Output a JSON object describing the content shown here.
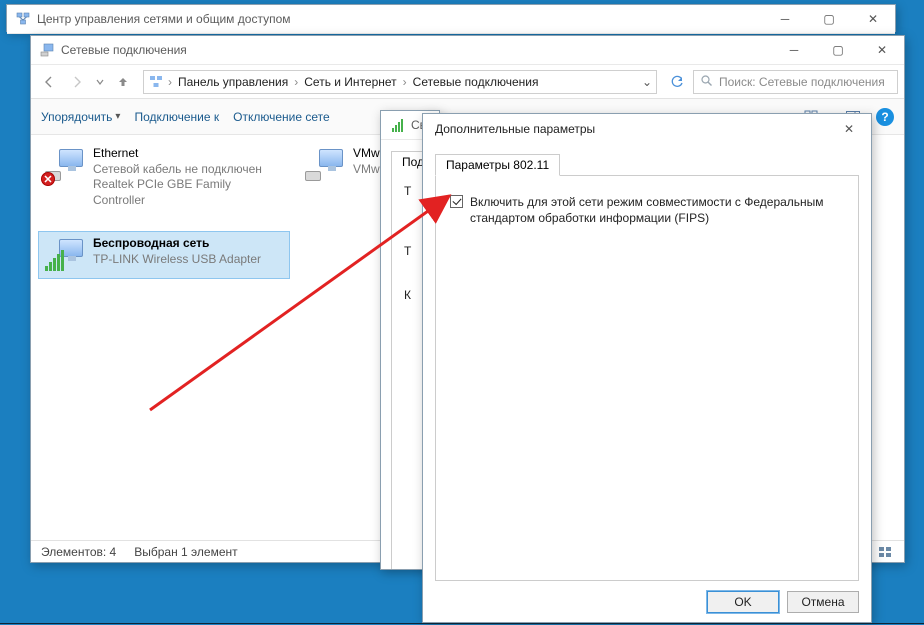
{
  "bg_window": {
    "title": "Центр управления сетями и общим доступом"
  },
  "window": {
    "title": "Сетевые подключения",
    "breadcrumbs": {
      "b1": "Панель управления",
      "b2": "Сеть и Интернет",
      "b3": "Сетевые подключения"
    },
    "search_placeholder": "Поиск: Сетевые подключения",
    "toolbar": {
      "organize": "Упорядочить",
      "connect_to": "Подключение к",
      "disable": "Отключение сете"
    },
    "conn1": {
      "name": "Ethernet",
      "status": "Сетевой кабель не подключен",
      "driver": "Realtek PCIe GBE Family Controller"
    },
    "conn2": {
      "name": "Беспроводная сеть",
      "status": "",
      "driver": "TP-LINK Wireless USB Adapter"
    },
    "conn3": {
      "name": "VMw",
      "status": "",
      "driver": "VMw"
    },
    "status": {
      "count": "Элементов: 4",
      "selected": "Выбран 1 элемент"
    }
  },
  "prop_dialog": {
    "title": "Сво",
    "tab": "Под",
    "row_t": "Т",
    "row_k": "К"
  },
  "adv_dialog": {
    "title": "Дополнительные параметры",
    "tab": "Параметры 802.11",
    "checkbox_label": "Включить для этой сети режим совместимости с Федеральным стандартом обработки информации (FIPS)",
    "ok": "OK",
    "cancel": "Отмена"
  }
}
